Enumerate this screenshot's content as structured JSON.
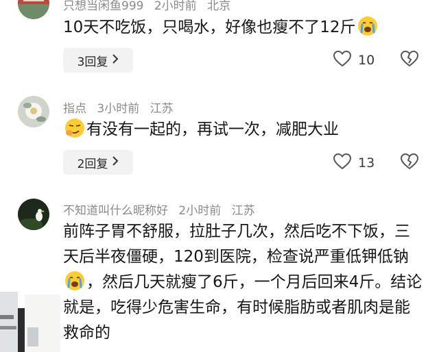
{
  "comments": [
    {
      "username": "只想当闲鱼999",
      "time": "2小时前",
      "location": "北京",
      "text": "10天不吃饭，只喝水，好像也瘦不了12斤",
      "emoji": "crying-face",
      "reply_label": "3回复",
      "likes": "10"
    },
    {
      "username": "指点",
      "time": "3小时前",
      "location": "江苏",
      "emoji": "smirking-face",
      "text": "有没有一起的，再试一次，减肥大业",
      "reply_label": "2回复",
      "likes": "13"
    },
    {
      "username": "不知道叫什么昵称好",
      "time": "2小时前",
      "location": "江苏",
      "text_part1": "前阵子胃不舒服，拉肚子几次，然后吃不下饭，三天后半夜僵硬，120到医院，检查说严重低钾低钠",
      "emoji": "crying-face",
      "text_part2": "，然后几天就瘦了6斤，一个月后回来4斤。结论就是，吃得少危害生命，有时候脂肪或者肌肉是能救命的"
    }
  ],
  "icons": {
    "like": "heart-outline-icon",
    "dislike": "broken-heart-icon",
    "chevron": "chevron-right-icon"
  },
  "colors": {
    "meta": "#8a8a8a",
    "reply_bg": "#f2f2f2"
  }
}
